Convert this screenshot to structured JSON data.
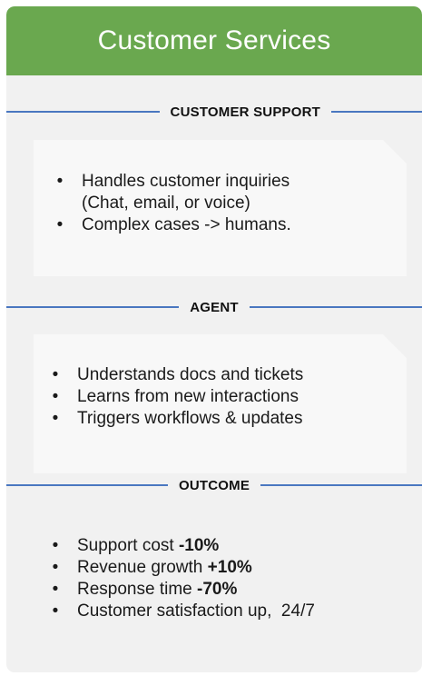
{
  "header": {
    "title": "Customer Services"
  },
  "sections": [
    {
      "label": "CUSTOMER SUPPORT",
      "items": [
        {
          "text": " Handles customer inquiries",
          "continuation": "(Chat, email, or voice)"
        },
        {
          "text": " Complex cases -> humans."
        }
      ]
    },
    {
      "label": "AGENT",
      "items": [
        {
          "text": "Understands docs and tickets"
        },
        {
          "text": "Learns from new interactions"
        },
        {
          "text": "Triggers workflows & updates"
        }
      ]
    },
    {
      "label": "OUTCOME",
      "items": [
        {
          "text": "Support cost ",
          "bold": "-10%"
        },
        {
          "text": "Revenue growth ",
          "bold": "+10%"
        },
        {
          "text": "Response time ",
          "bold": "-70%"
        },
        {
          "text": "Customer satisfaction up,  24/7"
        }
      ]
    }
  ],
  "colors": {
    "header": "#6aa84f",
    "divider": "#4a77c0",
    "card": "#f1f1f1"
  }
}
